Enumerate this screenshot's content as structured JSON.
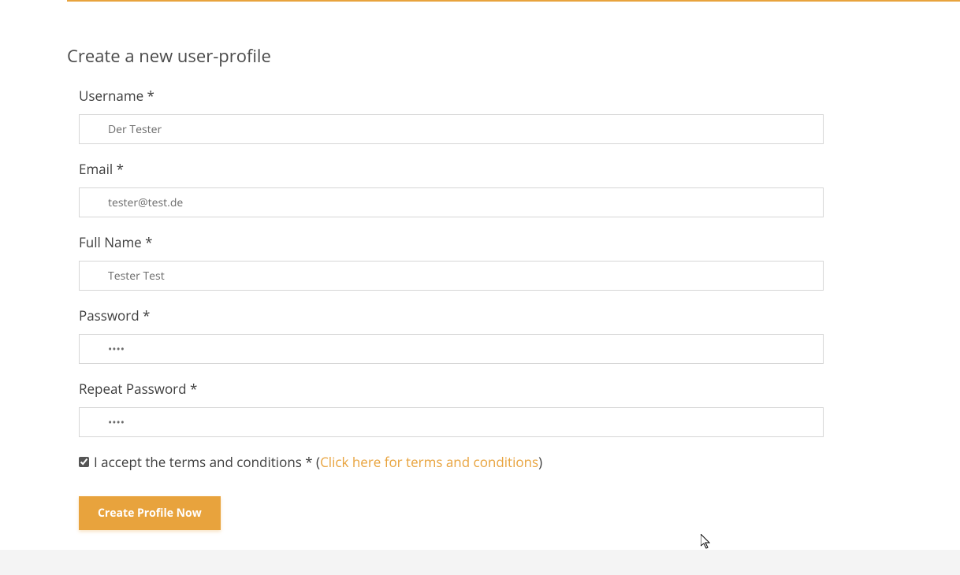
{
  "page": {
    "title": "Create a new user-profile"
  },
  "form": {
    "username": {
      "label": "Username *",
      "value": "Der Tester"
    },
    "email": {
      "label": "Email *",
      "value": "tester@test.de"
    },
    "fullname": {
      "label": "Full Name *",
      "value": "Tester Test"
    },
    "password": {
      "label": "Password *",
      "value": "••••"
    },
    "repeat_password": {
      "label": "Repeat Password *",
      "value": "••••"
    },
    "terms": {
      "prefix": "I accept the terms and conditions * (",
      "link": "Click here for terms and conditions",
      "suffix": ")",
      "checked": true
    },
    "submit_label": "Create Profile Now"
  }
}
